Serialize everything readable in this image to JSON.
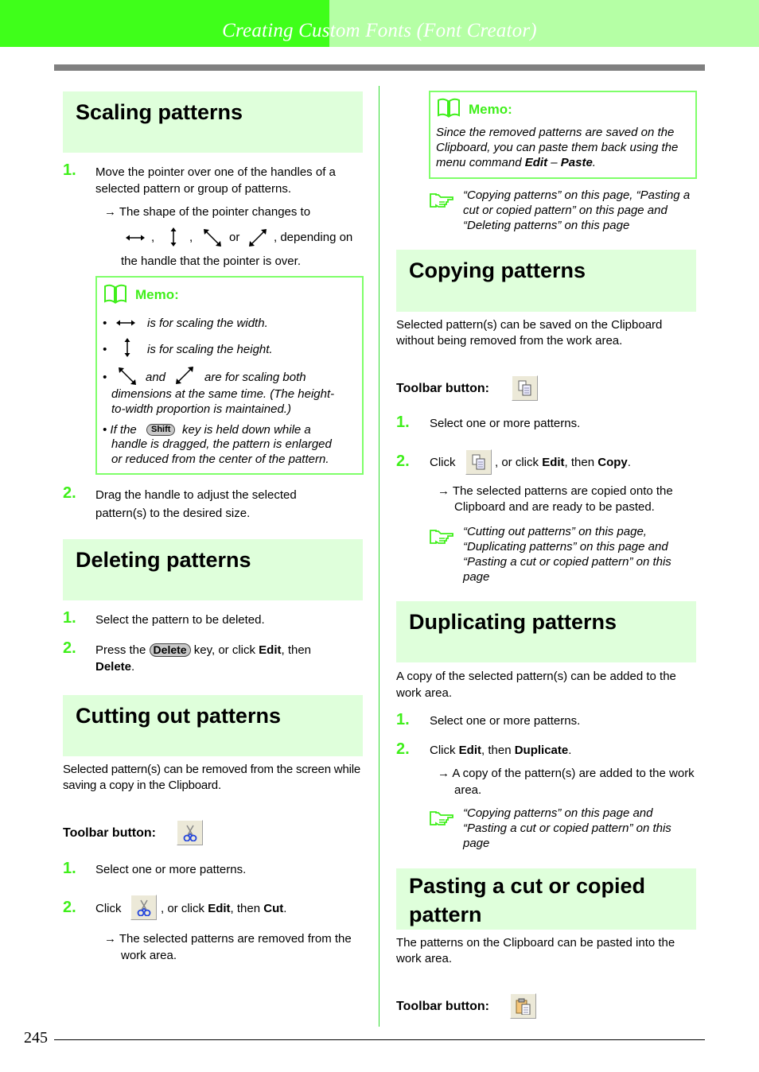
{
  "header": {
    "title": "Creating Custom Fonts (Font Creator)",
    "colors": {
      "dark_green": "#3fff1a",
      "light_green": "#b5ffa5",
      "section_bg": "#dfffdb",
      "accent": "#3fef1a"
    }
  },
  "page_number": "245",
  "left": {
    "scaling": {
      "title": "Scaling patterns",
      "step1_num": "1.",
      "step1_text": "Move the pointer over one of the handles of a selected pattern or group of patterns.",
      "step1_result": "→ The shape of the pointer changes to",
      "comma1": ",",
      "comma2": ",",
      "or": "or",
      "depending": ", depending on",
      "handle_text": "the handle that the pointer is over.",
      "cursor_icons": [
        "horizontal-resize-cursor",
        "vertical-resize-cursor",
        "diagonal-nwse-resize-cursor",
        "diagonal-nesw-resize-cursor"
      ],
      "memo": {
        "title": "Memo:",
        "bullet1": "is for scaling the width.",
        "bullet2": "is for scaling the height.",
        "bullet3_and": "and",
        "bullet3_a": "are for scaling both",
        "bullet3_b": "dimensions at the same time. (The height-",
        "bullet3_c": "to-width proportion is maintained.)",
        "bullet4_pre": "• If the",
        "shift_key": "Shift",
        "bullet4_a": "key is held down while a",
        "bullet4_b": "handle is dragged, the pattern is enlarged",
        "bullet4_c": "or reduced from the center of the pattern.",
        "bullet_glyph": "•"
      },
      "step2_num": "2.",
      "step2_text": "Drag the handle to adjust the selected pattern(s) to the desired size."
    },
    "deleting": {
      "title": "Deleting patterns",
      "step1_num": "1.",
      "step1_text": "Select the pattern to be deleted.",
      "step2_num": "2.",
      "step2_pre": "Press the",
      "delete_key": "Delete",
      "step2_mid": "key, or click",
      "edit": "Edit",
      "then": ", then",
      "delete_cmd": "Delete",
      "period": "."
    },
    "cutting": {
      "title": "Cutting out patterns",
      "intro": "Selected pattern(s) can be removed from the screen while saving a copy in the Clipboard.",
      "toolbar_label": "Toolbar button:",
      "step1_num": "1.",
      "step1_text": "Select one or more patterns.",
      "step2_num": "2.",
      "step2_pre": "Click",
      "step2_mid": ", or click",
      "edit": "Edit",
      "then": ", then",
      "cut_cmd": "Cut",
      "period": ".",
      "result": "→ The selected patterns are removed from the work area."
    }
  },
  "right": {
    "memo": {
      "title": "Memo:",
      "text_a": "Since the removed patterns are saved on the Clipboard, you can paste them back using the menu command",
      "edit": "Edit",
      "dash": " – ",
      "paste": "Paste",
      "period": "."
    },
    "ref1": "“Copying patterns”  on this page, “Pasting a cut or copied pattern”  on this page and “Deleting patterns”  on this page",
    "copying": {
      "title": "Copying patterns",
      "intro": "Selected pattern(s) can be saved on the Clipboard without being removed from the work area.",
      "toolbar_label": "Toolbar button:",
      "step1_num": "1.",
      "step1_text": "Select one or more patterns.",
      "step2_num": "2.",
      "step2_pre": "Click",
      "step2_mid": ", or click",
      "edit": "Edit",
      "then": ", then",
      "copy_cmd": "Copy",
      "period": ".",
      "result": "→ The selected patterns are copied onto the Clipboard and are ready to be pasted.",
      "ref": "“Cutting out patterns”  on this page, “Duplicating patterns”  on this page and “Pasting a cut or copied pattern”  on this page"
    },
    "duplicating": {
      "title": "Duplicating patterns",
      "intro": "A copy of the selected pattern(s) can be added to the work area.",
      "step1_num": "1.",
      "step1_text": "Select one or more patterns.",
      "step2_num": "2.",
      "step2_pre": "Click",
      "edit": "Edit",
      "then": ", then",
      "dup_cmd": "Duplicate",
      "period": ".",
      "result": "→ A copy of the pattern(s) are added to the work area.",
      "ref": "“Copying patterns”  on this page and “Pasting a cut or copied pattern”  on this page"
    },
    "pasting": {
      "title": "Pasting a cut or copied pattern",
      "intro": "The patterns on the Clipboard can be pasted into the work area.",
      "toolbar_label": "Toolbar button:"
    }
  }
}
